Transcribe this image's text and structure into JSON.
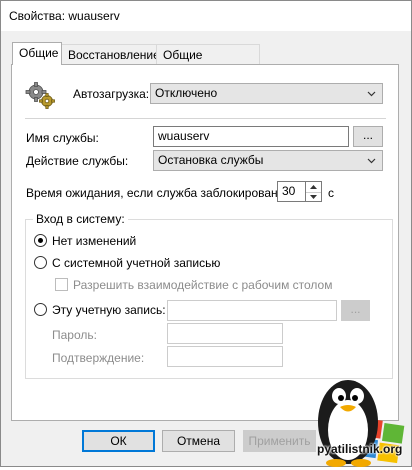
{
  "window": {
    "title": "Свойства: wuauserv"
  },
  "tabs": [
    {
      "label": "Общие",
      "active": true
    },
    {
      "label": "Восстановление",
      "active": false
    },
    {
      "label": "Общие параметры",
      "active": false
    }
  ],
  "startup": {
    "label": "Автозагрузка:",
    "value": "Отключено"
  },
  "service_name": {
    "label": "Имя службы:",
    "value": "wuauserv",
    "browse_label": "..."
  },
  "service_action": {
    "label": "Действие службы:",
    "value": "Остановка службы"
  },
  "timeout": {
    "label": "Время ожидания, если служба заблокирована:",
    "value": "30",
    "unit": "с"
  },
  "logon": {
    "group_title": "Вход в систему:",
    "no_change_label": "Нет изменений",
    "local_system_label": "С системной учетной записью",
    "interact_desktop_label": "Разрешить взаимодействие с рабочим столом",
    "this_account_label": "Эту учетную запись:",
    "this_account_value": "",
    "browse_label": "...",
    "password_label": "Пароль:",
    "confirm_label": "Подтверждение:",
    "selected": "no_change"
  },
  "footer": {
    "ok_label": "ОК",
    "cancel_label": "Отмена",
    "apply_label": "Применить"
  },
  "watermark": {
    "text": "pyatilistnik.org"
  },
  "icons": {
    "service": "gears-icon",
    "combo_arrow": "chevron-down-icon",
    "spin_up": "arrow-up-icon",
    "spin_down": "arrow-down-icon"
  },
  "colors": {
    "accent": "#0078d7",
    "dialog_bg": "#f0f0f0",
    "disabled_text": "#8c8c8c"
  }
}
